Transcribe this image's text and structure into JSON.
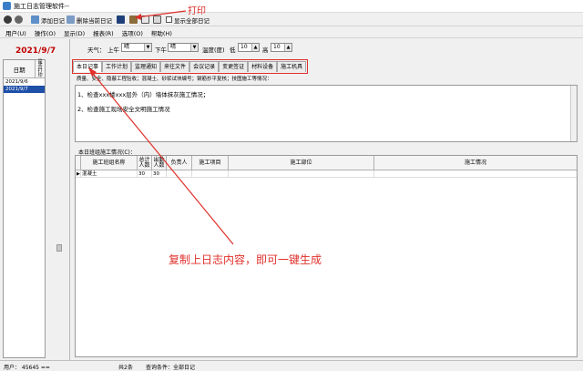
{
  "window": {
    "title": "施工日志管理软件--"
  },
  "toolbar": {
    "add_log": "添加日记",
    "delete_log": "删除当前日记",
    "show_all": "显示全部日记"
  },
  "menubar": [
    "用户(U)",
    "操作(O)",
    "显示(D)",
    "报表(R)",
    "选项(O)",
    "帮助(H)"
  ],
  "left": {
    "current_date": "2021/9/7",
    "list_header_date": "日期",
    "list_header_flag": "是否打印",
    "dates": [
      "2021/9/6",
      "2021/9/7"
    ],
    "selected_index": 1
  },
  "filter": {
    "weather_label": "天气：",
    "am_label": "上午",
    "am_value": "晴",
    "pm_label": "下午",
    "pm_value": "晴",
    "temp_label": "温度(度)",
    "low_label": "低",
    "low_value": "10",
    "high_label": "高",
    "high_value": "10"
  },
  "tabs": [
    "本日记事",
    "工作计划",
    "监理通知",
    "来往文件",
    "会议记录",
    "变更签证",
    "材料设备",
    "施工机具"
  ],
  "active_tab": 0,
  "subtabs": "质量、安全、隐蔽工程验收；混凝土、砂浆试块编号；钢筋抄平复核；技图施工等情况：",
  "editor_lines": [
    "1、检查xxx楼xxx层外（内）墙体抹灰施工情况；",
    "2、检查施工现场安全文明施工情况"
  ],
  "grid": {
    "label": "本日班组施工情况(C)：",
    "columns": [
      "施工班组名称",
      "总计人数",
      "出勤人数",
      "负责人",
      "施工项目",
      "施工部位",
      "施工情况"
    ],
    "rows": [
      [
        "混凝土",
        "30",
        "30",
        "",
        "",
        "",
        ""
      ]
    ]
  },
  "status": {
    "user": "用户： 45645 ==",
    "count": "共2条",
    "query": "查询条件：全部日记"
  },
  "annotations": {
    "print": "打印",
    "copy": "复制上日志内容，即可一键生成"
  },
  "colors": {
    "annotation": "#e0302a",
    "date": "#c00000",
    "selection": "#1e50a8"
  }
}
